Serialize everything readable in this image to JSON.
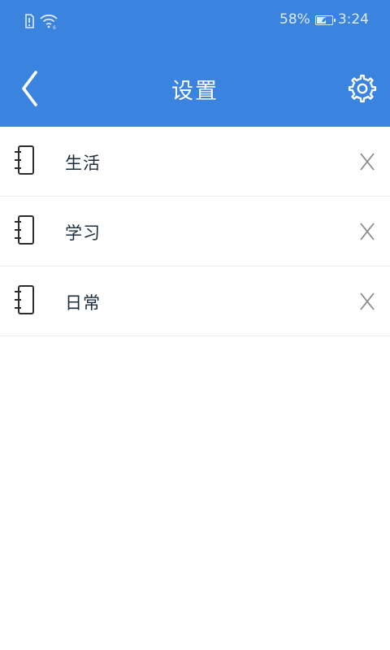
{
  "status_bar": {
    "battery_percent": "58%",
    "battery_level": 0.58,
    "time": "3:24",
    "icons": [
      "sim-alert-icon",
      "wifi-icon",
      "battery-icon"
    ]
  },
  "header": {
    "title": "设置",
    "back_icon": "chevron-left-icon",
    "settings_icon": "gear-icon",
    "background_color": "#3a84e0"
  },
  "list": {
    "items": [
      {
        "label": "生活",
        "icon": "notebook-icon",
        "action_icon": "close-icon"
      },
      {
        "label": "学习",
        "icon": "notebook-icon",
        "action_icon": "close-icon"
      },
      {
        "label": "日常",
        "icon": "notebook-icon",
        "action_icon": "close-icon"
      }
    ]
  }
}
